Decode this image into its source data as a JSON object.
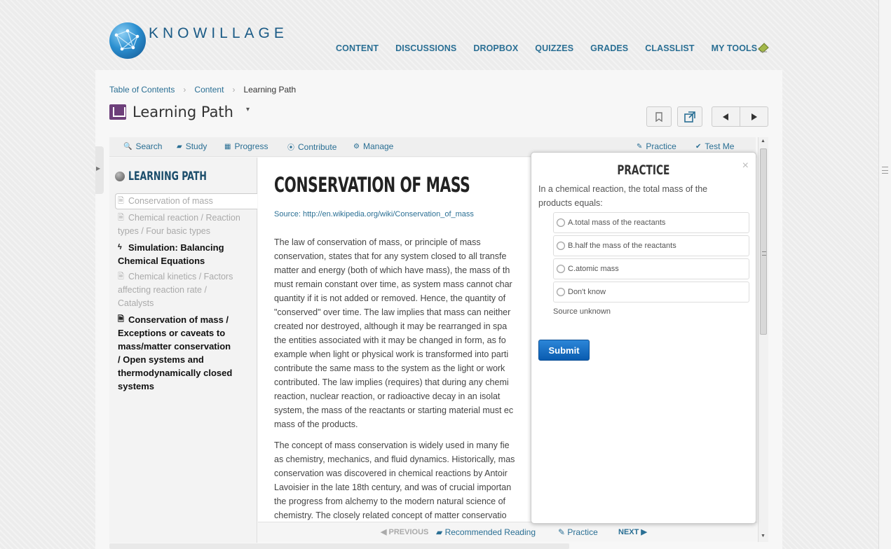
{
  "brand": {
    "name": "KNOWILLAGE"
  },
  "topnav": {
    "items": [
      "CONTENT",
      "DISCUSSIONS",
      "DROPBOX",
      "QUIZZES",
      "GRADES",
      "CLASSLIST",
      "MY TOOLS"
    ],
    "caret": "▾"
  },
  "breadcrumb": [
    "Table of Contents",
    "Content",
    "Learning Path"
  ],
  "page": {
    "title": "Learning Path",
    "dropdown": "▾"
  },
  "toolbar": {
    "left": [
      {
        "icon": "search-icon",
        "glyph": "🔍",
        "label": "Search"
      },
      {
        "icon": "book-icon",
        "glyph": "▰",
        "label": "Study"
      },
      {
        "icon": "chart-icon",
        "glyph": "▦",
        "label": "Progress"
      },
      {
        "icon": "contribute-icon",
        "glyph": "⦿",
        "label": "Contribute"
      },
      {
        "icon": "gear-icon",
        "glyph": "⚙",
        "label": "Manage"
      }
    ],
    "right": [
      {
        "icon": "pencil-icon",
        "glyph": "✎",
        "label": "Practice"
      },
      {
        "icon": "check-circle-icon",
        "glyph": "✔",
        "label": "Test Me"
      }
    ]
  },
  "sidebar": {
    "title": "LEARNING PATH",
    "current": "Conservation of mass",
    "items": [
      {
        "lines": [
          "Chemical reaction / Reaction",
          "types / Four basic types"
        ],
        "style": "muted",
        "icon": "document-icon"
      },
      {
        "lines": [
          "Simulation: Balancing",
          "Chemical Equations"
        ],
        "style": "bold",
        "icon": "lightning-icon"
      },
      {
        "lines": [
          "Chemical kinetics / Factors",
          "affecting reaction rate /",
          "Catalysts"
        ],
        "style": "muted",
        "icon": "document-icon"
      },
      {
        "lines": [
          "Conservation of mass /",
          "Exceptions or caveats to",
          "mass/matter conservation",
          "/ Open systems and",
          "thermodynamically closed",
          "systems"
        ],
        "style": "bold",
        "icon": "document-icon"
      }
    ]
  },
  "article": {
    "title": "CONSERVATION OF MASS",
    "source": "Source: http://en.wikipedia.org/wiki/Conservation_of_mass",
    "p1": [
      "The law of conservation of mass, or principle of mass",
      "conservation, states that for any system closed to all transfe",
      "matter and energy (both of which have mass), the mass of th",
      "must remain constant over time, as system mass cannot char",
      "quantity if it is not added or removed. Hence, the quantity of",
      "\"conserved\" over time. The law implies that mass can neither",
      "created nor destroyed, although it may be rearranged in spa",
      "the entities associated with it may be changed in form, as fo",
      "example when light or physical work is transformed into parti",
      "contribute the same mass to the system as the light or work",
      "contributed. The law implies (requires) that during any chemi",
      "reaction, nuclear reaction, or radioactive decay in an isolat",
      "system, the mass of the reactants or starting material must ec",
      "mass of the products."
    ],
    "p2": [
      "The concept of mass conservation is widely used in many fie",
      "as chemistry, mechanics, and fluid dynamics. Historically, mas",
      "conservation was discovered in chemical reactions by Antoir",
      "Lavoisier in the late 18th century, and was of crucial importan",
      "the progress from alchemy to the modern natural science of",
      "chemistry. The closely related concept of matter conservatio"
    ]
  },
  "bottomnav": {
    "previous": "PREVIOUS",
    "recommended": "Recommended Reading",
    "practice": "Practice",
    "next": "NEXT"
  },
  "practice": {
    "title": "PRACTICE",
    "close": "×",
    "question": "In a chemical reaction, the total mass of the products equals:",
    "options": [
      "A.total mass of the reactants",
      "B.half the mass of the reactants",
      "C.atomic mass",
      "Don't know"
    ],
    "source": "Source unknown",
    "submit": "Submit"
  },
  "colors": {
    "link": "#2a6f94",
    "submit": "#0a5cb0",
    "brand": "#1b5b86"
  }
}
